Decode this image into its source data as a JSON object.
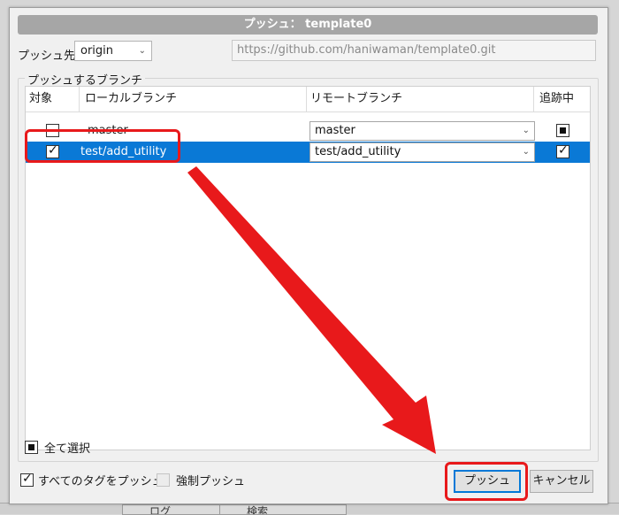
{
  "dialog": {
    "title": "プッシュ： template0",
    "push_dest_label": "プッシュ先:",
    "remote_value": "origin",
    "remote_url": "https://github.com/haniwaman/template0.git",
    "branches_group_label": "プッシュするブランチ",
    "columns": {
      "target": "対象",
      "local": "ローカルブランチ",
      "remote": "リモートブランチ",
      "tracking": "追跡中"
    },
    "rows": [
      {
        "target_checked": false,
        "local": "master",
        "remote": "master",
        "tracking_state": "partial",
        "selected": false
      },
      {
        "target_checked": true,
        "local": "test/add_utility",
        "remote": "test/add_utility",
        "tracking_state": "checked",
        "selected": true
      }
    ],
    "select_all_label": "全て選択",
    "push_all_tags_label": "すべてのタグをプッシュ",
    "force_push_label": "強制プッシュ",
    "push_button": "プッシュ",
    "cancel_button": "キャンセル"
  },
  "background": {
    "tab1": "ログ",
    "tab2": "検索"
  },
  "colors": {
    "selection": "#0a79d6",
    "annotation": "#e8191b"
  }
}
